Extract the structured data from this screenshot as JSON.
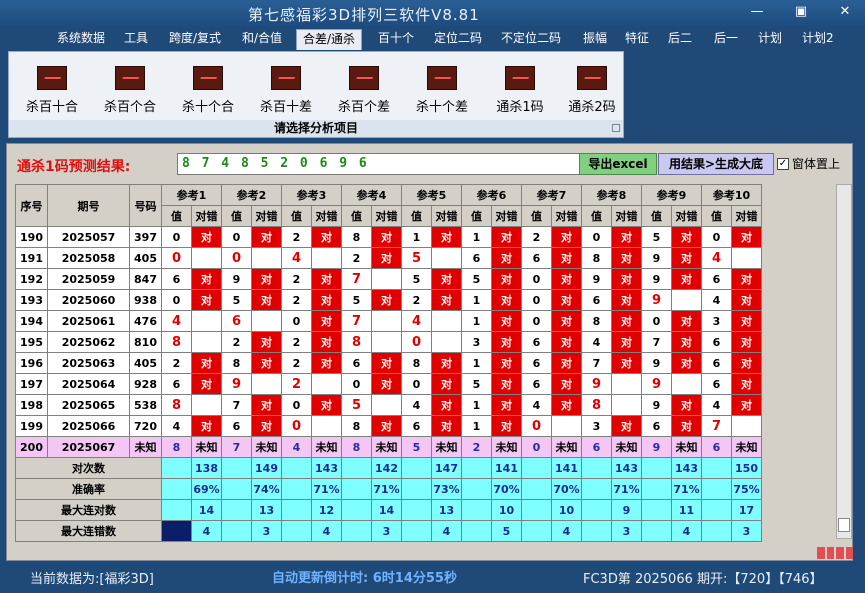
{
  "window": {
    "title": "第七感福彩3D排列三软件V8.81",
    "buttons": [
      "—",
      "▣",
      "✕"
    ]
  },
  "menu": [
    "系统数据",
    "工具",
    "跨度/复式",
    "和/合值",
    "合差/通杀",
    "百十个",
    "定位二码",
    "不定位二码",
    "振幅",
    "特征",
    "后二",
    "后一",
    "计划",
    "计划2"
  ],
  "menu_active": "合差/通杀",
  "ribbon": {
    "buttons": [
      "杀百十合",
      "杀百个合",
      "杀十个合",
      "杀百十差",
      "杀百个差",
      "杀十个差",
      "通杀1码",
      "通杀2码"
    ],
    "caption": "请选择分析项目"
  },
  "prediction": {
    "label": "通杀1码预测结果:",
    "value": "8 7 4 8 5 2 0 6 9 6",
    "export_label": "导出excel",
    "generate_label": "用结果>生成大底",
    "topmost_label": "窗体置上",
    "topmost_checked": "✓"
  },
  "table": {
    "headers": [
      "序号",
      "期号",
      "号码"
    ],
    "ref_headers": [
      "参考1",
      "参考2",
      "参考3",
      "参考4",
      "参考5",
      "参考6",
      "参考7",
      "参考8",
      "参考9",
      "参考10"
    ],
    "sub_headers": [
      "值",
      "对错"
    ],
    "hit_text": "对",
    "rows": [
      {
        "seq": "190",
        "issue": "2025057",
        "num": "397",
        "vals": [
          "0",
          "0",
          "2",
          "8",
          "1",
          "1",
          "2",
          "0",
          "5",
          "0"
        ],
        "hits": [
          1,
          1,
          1,
          1,
          1,
          1,
          1,
          1,
          1,
          1
        ]
      },
      {
        "seq": "191",
        "issue": "2025058",
        "num": "405",
        "vals": [
          "0",
          "0",
          "4",
          "2",
          "5",
          "6",
          "6",
          "8",
          "9",
          "4"
        ],
        "hits": [
          0,
          0,
          0,
          1,
          0,
          1,
          1,
          1,
          1,
          0
        ]
      },
      {
        "seq": "192",
        "issue": "2025059",
        "num": "847",
        "vals": [
          "6",
          "9",
          "2",
          "7",
          "5",
          "5",
          "0",
          "9",
          "9",
          "6"
        ],
        "hits": [
          1,
          1,
          1,
          0,
          1,
          1,
          1,
          1,
          1,
          1
        ]
      },
      {
        "seq": "193",
        "issue": "2025060",
        "num": "938",
        "vals": [
          "0",
          "5",
          "2",
          "5",
          "2",
          "1",
          "0",
          "6",
          "9",
          "4"
        ],
        "hits": [
          1,
          1,
          1,
          1,
          1,
          1,
          1,
          1,
          0,
          1
        ]
      },
      {
        "seq": "194",
        "issue": "2025061",
        "num": "476",
        "vals": [
          "4",
          "6",
          "0",
          "7",
          "4",
          "1",
          "0",
          "8",
          "0",
          "3"
        ],
        "hits": [
          0,
          0,
          1,
          0,
          0,
          1,
          1,
          1,
          1,
          1
        ]
      },
      {
        "seq": "195",
        "issue": "2025062",
        "num": "810",
        "vals": [
          "8",
          "2",
          "2",
          "8",
          "0",
          "3",
          "6",
          "4",
          "7",
          "6"
        ],
        "hits": [
          0,
          1,
          1,
          0,
          0,
          1,
          1,
          1,
          1,
          1
        ]
      },
      {
        "seq": "196",
        "issue": "2025063",
        "num": "405",
        "vals": [
          "2",
          "8",
          "2",
          "6",
          "8",
          "1",
          "6",
          "7",
          "9",
          "6"
        ],
        "hits": [
          1,
          1,
          1,
          1,
          1,
          1,
          1,
          1,
          1,
          1
        ]
      },
      {
        "seq": "197",
        "issue": "2025064",
        "num": "928",
        "vals": [
          "6",
          "9",
          "2",
          "0",
          "0",
          "5",
          "6",
          "9",
          "9",
          "6"
        ],
        "hits": [
          1,
          0,
          0,
          1,
          1,
          1,
          1,
          0,
          0,
          1
        ]
      },
      {
        "seq": "198",
        "issue": "2025065",
        "num": "538",
        "vals": [
          "8",
          "7",
          "0",
          "5",
          "4",
          "1",
          "4",
          "8",
          "9",
          "4"
        ],
        "hits": [
          0,
          1,
          1,
          0,
          1,
          1,
          1,
          0,
          1,
          1
        ]
      },
      {
        "seq": "199",
        "issue": "2025066",
        "num": "720",
        "vals": [
          "4",
          "6",
          "0",
          "8",
          "6",
          "1",
          "0",
          "3",
          "6",
          "7"
        ],
        "hits": [
          1,
          1,
          0,
          1,
          1,
          1,
          0,
          1,
          1,
          0
        ]
      }
    ],
    "pred_row": {
      "seq": "200",
      "issue": "2025067",
      "num": "未知",
      "vals": [
        "8",
        "7",
        "4",
        "8",
        "5",
        "2",
        "0",
        "6",
        "9",
        "6"
      ],
      "status": "未知"
    },
    "stats": [
      {
        "label": "对次数",
        "values": [
          "138",
          "149",
          "143",
          "142",
          "147",
          "141",
          "141",
          "143",
          "143",
          "150"
        ]
      },
      {
        "label": "准确率",
        "values": [
          "69%",
          "74%",
          "71%",
          "71%",
          "73%",
          "70%",
          "70%",
          "71%",
          "71%",
          "75%"
        ]
      },
      {
        "label": "最大连对数",
        "values": [
          "14",
          "13",
          "12",
          "14",
          "13",
          "10",
          "10",
          "9",
          "11",
          "17"
        ]
      },
      {
        "label": "最大连错数",
        "values": [
          "4",
          "3",
          "4",
          "3",
          "4",
          "5",
          "4",
          "3",
          "4",
          "3"
        ]
      }
    ]
  },
  "statusbar": {
    "current_data": "当前数据为:[福彩3D]",
    "countdown": "自动更新倒计时:  6时14分55秒",
    "draw_info": "FC3D第 2025066 期开:【720】【746】"
  }
}
